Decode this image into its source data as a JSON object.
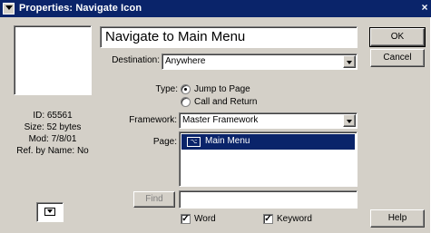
{
  "window": {
    "title": "Properties: Navigate Icon",
    "close_glyph": "×"
  },
  "left_panel": {
    "id_text": "ID: 65561",
    "size_text": "Size: 52 bytes",
    "mod_text": "Mod: 7/8/01",
    "ref_text": "Ref. by Name: No",
    "icon": "navigate-icon"
  },
  "name_field": {
    "value": "Navigate to Main Menu"
  },
  "destination": {
    "label": "Destination:",
    "value": "Anywhere"
  },
  "type": {
    "label": "Type:",
    "options": [
      {
        "label": "Jump to Page",
        "selected": true
      },
      {
        "label": "Call and Return",
        "selected": false
      }
    ]
  },
  "framework": {
    "label": "Framework:",
    "value": "Master Framework"
  },
  "page": {
    "label": "Page:",
    "items": [
      {
        "label": "Main Menu",
        "icon": "page-icon",
        "icon_text": "⌥",
        "selected": true
      }
    ]
  },
  "find": {
    "button_label": "Find",
    "value": "",
    "word": {
      "label": "Word",
      "checked": true
    },
    "keyword": {
      "label": "Keyword",
      "checked": true
    }
  },
  "buttons": {
    "ok": "OK",
    "cancel": "Cancel",
    "help": "Help"
  },
  "colors": {
    "face": "#d4d0c8",
    "title_bar": "#0a246a",
    "selection": "#0a246a"
  }
}
